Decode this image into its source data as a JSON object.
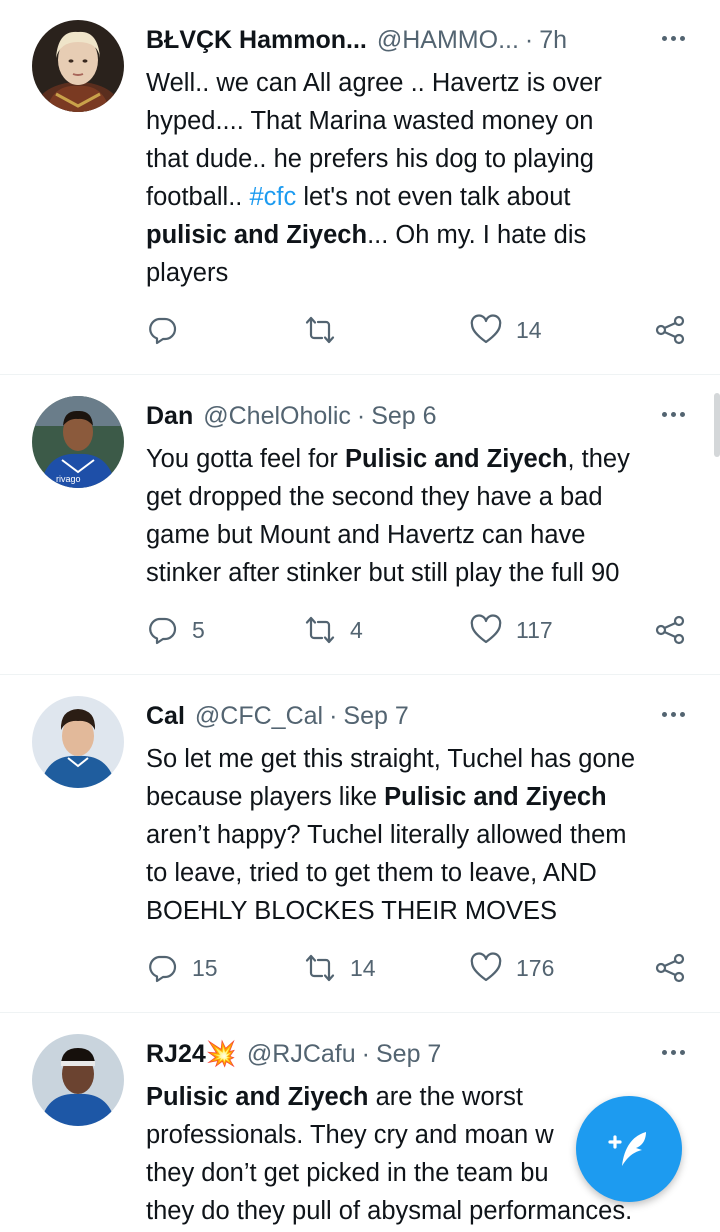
{
  "tweets": [
    {
      "name": "BŁVÇK Hammon...",
      "handle": "@HAMMO...",
      "time": "7h",
      "lines": [
        [
          {
            "t": "Well.. we can All agree .. Havertz is over"
          }
        ],
        [
          {
            "t": "hyped.... That Marina wasted money on"
          }
        ],
        [
          {
            "t": "that dude.. he prefers his dog to playing"
          }
        ],
        [
          {
            "t": "football.. "
          },
          {
            "t": "#cfc",
            "k": "hashtag"
          },
          {
            "t": " let's not even talk about"
          }
        ],
        [
          {
            "t": "pulisic and Ziyech",
            "k": "bold"
          },
          {
            "t": "... Oh my. I hate dis"
          }
        ],
        [
          {
            "t": "players"
          }
        ]
      ],
      "replies": "",
      "retweets": "",
      "likes": "14",
      "avatar": "woman-portrait"
    },
    {
      "name": "Dan",
      "handle": "@ChelOholic",
      "time": "Sep 6",
      "lines": [
        [
          {
            "t": "You gotta feel for "
          },
          {
            "t": "Pulisic and Ziyech",
            "k": "bold"
          },
          {
            "t": ", they"
          }
        ],
        [
          {
            "t": "get dropped the second they have a bad"
          }
        ],
        [
          {
            "t": "game but Mount and Havertz can have"
          }
        ],
        [
          {
            "t": "stinker after stinker but still play the full 90"
          }
        ]
      ],
      "replies": "5",
      "retweets": "4",
      "likes": "117",
      "avatar": "player-blue-kit",
      "avatar_text": "rivago"
    },
    {
      "name": "Cal",
      "handle": "@CFC_Cal",
      "time": "Sep 7",
      "lines": [
        [
          {
            "t": "So let me get this straight, Tuchel has gone"
          }
        ],
        [
          {
            "t": "because players like "
          },
          {
            "t": "Pulisic and Ziyech",
            "k": "bold"
          }
        ],
        [
          {
            "t": "aren’t happy? Tuchel literally allowed them"
          }
        ],
        [
          {
            "t": "to leave, tried to get them to leave, AND"
          }
        ],
        [
          {
            "t": "BOEHLY BLOCKES THEIR MOVES"
          }
        ]
      ],
      "replies": "15",
      "retweets": "14",
      "likes": "176",
      "avatar": "player-portrait"
    },
    {
      "name": "RJ24💥",
      "handle": "@RJCafu",
      "time": "Sep 7",
      "lines": [
        [
          {
            "t": "Pulisic and Ziyech",
            "k": "bold"
          },
          {
            "t": " are the worst"
          }
        ],
        [
          {
            "t": "professionals. They cry and moan w"
          }
        ],
        [
          {
            "t": "they don’t get picked in the team bu"
          }
        ],
        [
          {
            "t": "they do they pull of abysmal performances."
          }
        ]
      ],
      "replies": "",
      "retweets": "",
      "likes": "",
      "avatar": "player-headband"
    }
  ],
  "icons": {
    "reply": "reply-icon",
    "retweet": "retweet-icon",
    "like": "heart-icon",
    "share": "share-icon",
    "more": "more-icon",
    "compose": "compose-tweet-icon"
  },
  "colors": {
    "accent": "#1d9bf0",
    "text": "#0f1419",
    "muted": "#536471",
    "divider": "#eff3f4"
  }
}
